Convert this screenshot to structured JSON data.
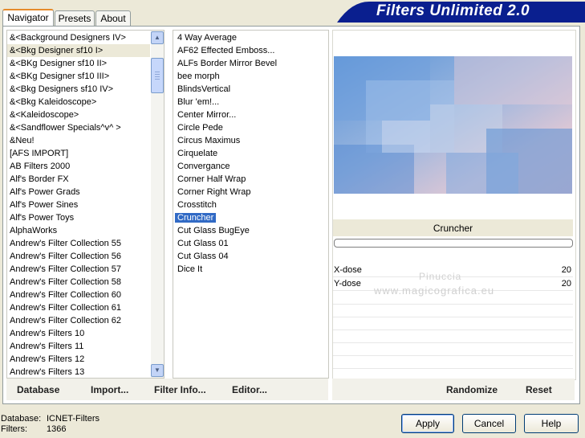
{
  "tabs": [
    {
      "label": "Navigator"
    },
    {
      "label": "Presets"
    },
    {
      "label": "About"
    }
  ],
  "header": {
    "title": "Filters Unlimited 2.0"
  },
  "categories": [
    "&<Background Designers IV>",
    "&<Bkg Designer sf10 I>",
    "&<BKg Designer sf10 II>",
    "&<BKg Designer sf10 III>",
    "&<Bkg Designers sf10 IV>",
    "&<Bkg Kaleidoscope>",
    "&<Kaleidoscope>",
    "&<Sandflower Specials^v^ >",
    "&Neu!",
    "[AFS IMPORT]",
    "AB Filters 2000",
    "Alf's Border FX",
    "Alf's Power Grads",
    "Alf's Power Sines",
    "Alf's Power Toys",
    "AlphaWorks",
    "Andrew's Filter Collection 55",
    "Andrew's Filter Collection 56",
    "Andrew's Filter Collection 57",
    "Andrew's Filter Collection 58",
    "Andrew's Filter Collection 60",
    "Andrew's Filter Collection 61",
    "Andrew's Filter Collection 62",
    "Andrew's Filters 10",
    "Andrew's Filters 11",
    "Andrew's Filters 12",
    "Andrew's Filters 13"
  ],
  "filters": [
    "4 Way Average",
    "AF62 Effected Emboss...",
    "ALFs Border Mirror Bevel",
    "bee morph",
    "BlindsVertical",
    "Blur 'em!...",
    "Center Mirror...",
    "Circle Pede",
    "Circus Maximus",
    "Cirquelate",
    "Convergance",
    "Corner Half Wrap",
    "Corner Right Wrap",
    "Crosstitch",
    "Cruncher",
    "Cut Glass  BugEye",
    "Cut Glass 01",
    "Cut Glass 04",
    "Dice It"
  ],
  "selected_category_index": 1,
  "selected_filter_index": 14,
  "preview": {
    "filter_name": "Cruncher"
  },
  "params": [
    {
      "label": "X-dose",
      "value": "20"
    },
    {
      "label": "Y-dose",
      "value": "20"
    }
  ],
  "watermark": {
    "line1": "Pinuccia",
    "line2": "www.magicografica.eu"
  },
  "left_buttons": {
    "database": "Database",
    "import": "Import...",
    "filter_info": "Filter Info...",
    "editor": "Editor..."
  },
  "right_buttons": {
    "randomize": "Randomize",
    "reset": "Reset"
  },
  "status": {
    "database_label": "Database:",
    "database_value": "ICNET-Filters",
    "filters_label": "Filters:",
    "filters_value": "1366"
  },
  "dialog_buttons": {
    "apply": "Apply",
    "cancel": "Cancel",
    "help": "Help"
  }
}
